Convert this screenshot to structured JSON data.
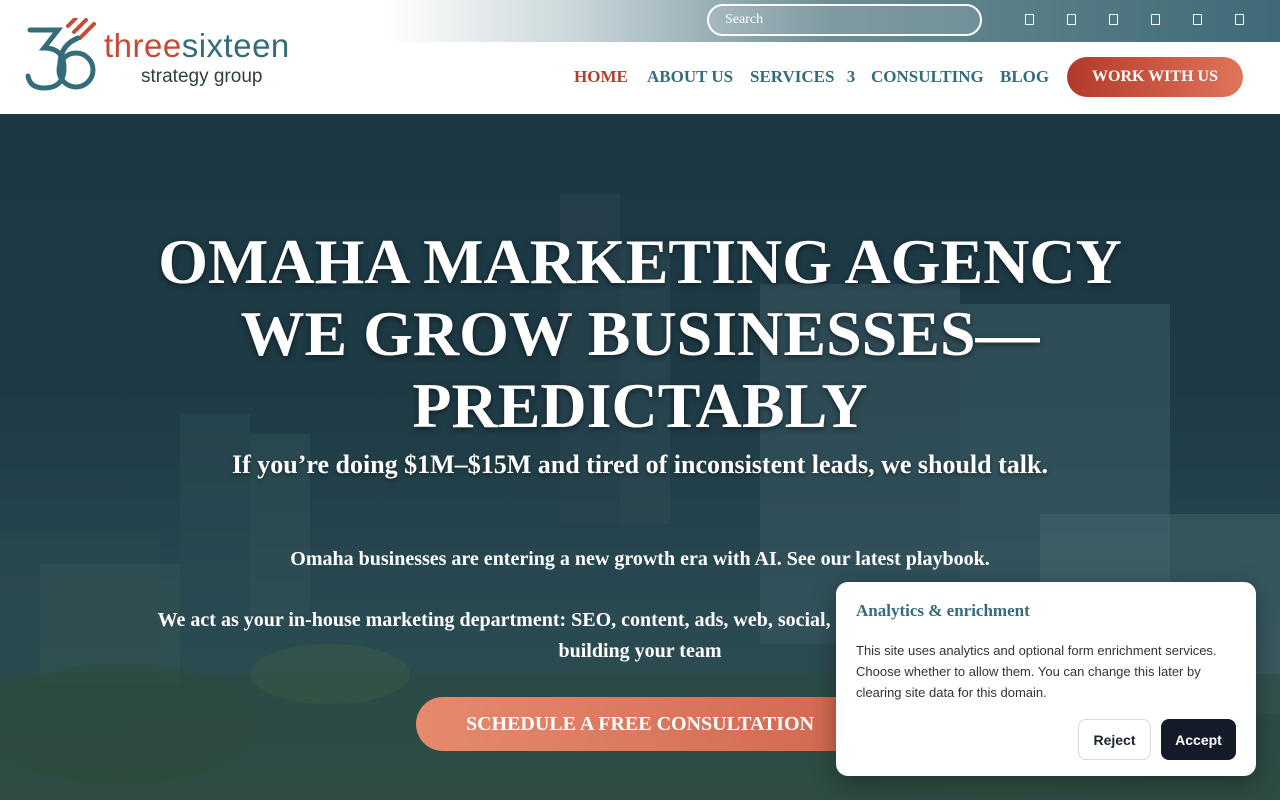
{
  "header": {
    "search_placeholder": "Search",
    "social_icons": [
      "social-icon-1",
      "social-icon-2",
      "social-icon-3",
      "social-icon-4",
      "social-icon-5",
      "social-icon-6"
    ],
    "logo": {
      "word_part1": "three",
      "word_part2": "sixteen",
      "tagline": "strategy group"
    },
    "nav": [
      {
        "label": "HOME",
        "active": true
      },
      {
        "label": "ABOUT US",
        "active": false
      },
      {
        "label": "SERVICES",
        "active": false
      },
      {
        "label": "CONSULTING",
        "active": false
      },
      {
        "label": "BLOG",
        "active": false
      }
    ],
    "services_dropdown_glyph": "3",
    "cta_label": "WORK WITH US"
  },
  "hero": {
    "title_line1": "OMAHA MARKETING AGENCY",
    "title_line2": "WE GROW BUSINESSES—",
    "title_line3": "PREDICTABLY",
    "subtitle": "If you’re doing $1M–$15M and tired of inconsistent leads, we should talk.",
    "paragraph1": "Omaha businesses are entering a new growth era with AI. See our latest playbook.",
    "paragraph2": "We act as your in-house marketing department: SEO, content, ads, web, social, design, and AI visibility—without building your team",
    "cta_label": "SCHEDULE A FREE CONSULTATION"
  },
  "consent": {
    "title": "Analytics & enrichment",
    "body": "This site uses analytics and optional form enrichment services. Choose whether to allow them. You can change this later by clearing site data for this domain.",
    "reject_label": "Reject",
    "accept_label": "Accept"
  },
  "colors": {
    "brand_red": "#c54b36",
    "brand_teal": "#356c7a",
    "nav_active": "#b3402b",
    "cta_gradient_start": "#b23a2b",
    "cta_gradient_end": "#e0745a",
    "accept_button": "#141a28"
  }
}
